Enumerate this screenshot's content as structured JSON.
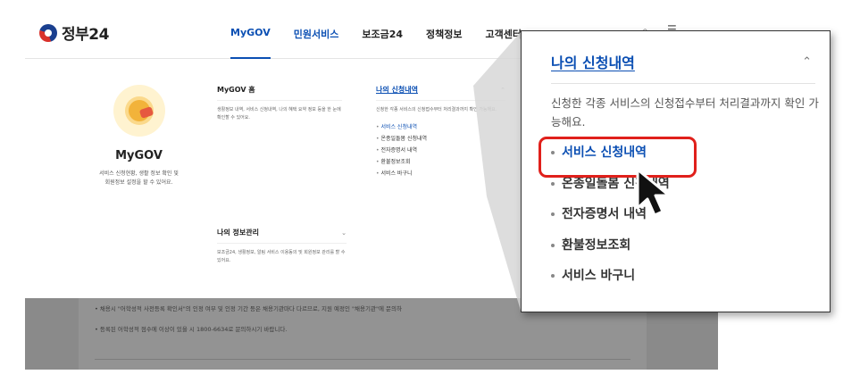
{
  "header": {
    "logo_text": "정부24",
    "nav": [
      "MyGOV",
      "민원서비스",
      "보조금24",
      "정책정보",
      "고객센터"
    ],
    "search_glyph": "⌕",
    "menu_glyph": "☰"
  },
  "mygov": {
    "title": "MyGOV",
    "desc": "서비스 신청현황, 생활 정보 확인 및\n회원정보 설정을 할 수 있어요."
  },
  "menu": {
    "home": {
      "title": "MyGOV 홈",
      "desc": "생활정보 내역, 서비스 신청내역, 나의 혜택 요약 정보 등을 한 눈에 확인할 수 있어요."
    },
    "apply": {
      "title": "나의 신청내역",
      "desc": "신청한 각종 서비스의 신청접수부터 처리결과까지 확인 가능해요.",
      "items": [
        "서비스 신청내역",
        "온종일돌봄 신청내역",
        "전자증명서 내역",
        "환불정보조회",
        "서비스 바구니"
      ]
    },
    "info": {
      "title": "나의 정보관리",
      "desc": "보조금24, 생활정보, 알림 서비스 이용동의 및 회원정보 관리를 할 수 있어요."
    },
    "chevron_up": "⌃",
    "chevron_down": "⌄"
  },
  "background_notes": [
    "• 채용시 \"어학성적 사전등록 확인서\"의 인정 여부 및 인정 기간 등은 채용기관마다 다르므로, 지원 예정인 \"채용기관\"에 문의하",
    "• 등록된 어학성적 점수에 이상이 있을 시 1800-6634로 문의하시기 바랍니다."
  ],
  "zoom": {
    "title": "나의 신청내역",
    "chevron": "⌃",
    "desc": "신청한 각종 서비스의 신청접수부터 처리결과까지 확인 가능해요.",
    "items": [
      "서비스 신청내역",
      "온종일돌봄 신청내역",
      "전자증명서 내역",
      "환불정보조회",
      "서비스 바구니"
    ],
    "highlight_color": "#e0201b"
  },
  "colors": {
    "accent": "#0b4fb3",
    "highlight": "#e0201b"
  }
}
